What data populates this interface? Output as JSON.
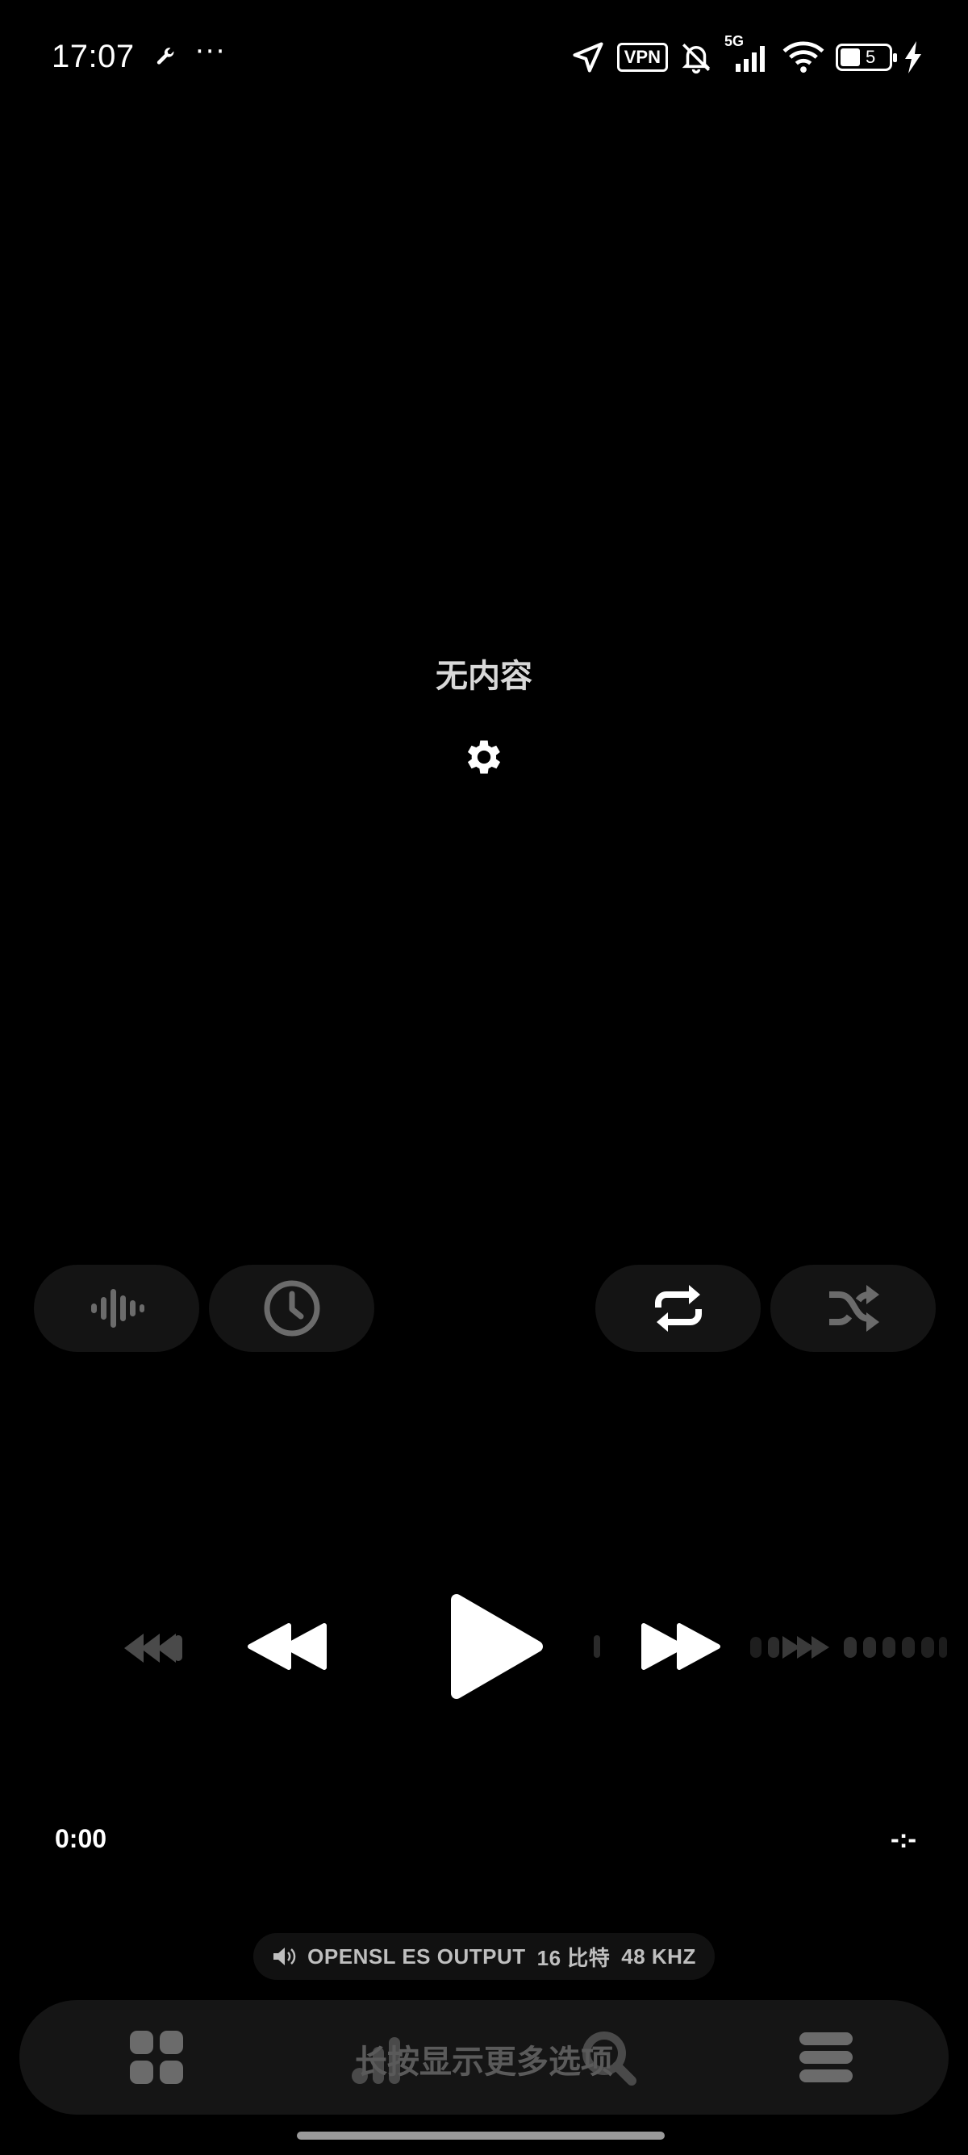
{
  "status_bar": {
    "time": "17:07",
    "more": "···",
    "vpn": "VPN",
    "network": "5G",
    "battery_level": "5"
  },
  "empty_state": {
    "message": "无内容"
  },
  "controls": {
    "repeat_label": "repeat",
    "shuffle_label": "shuffle"
  },
  "playback": {
    "elapsed": "0:00",
    "remaining": "-:-"
  },
  "output": {
    "device": "OPENSL ES OUTPUT",
    "bit_depth": "16 比特",
    "sample_rate": "48 KHZ"
  },
  "bottom_nav": {
    "toast": "长按显示更多选项"
  },
  "colors": {
    "background": "#000000",
    "pill": "#141414",
    "nav": "#151515",
    "icon_dim": "#6b6b6b",
    "icon_bright": "#ffffff"
  }
}
